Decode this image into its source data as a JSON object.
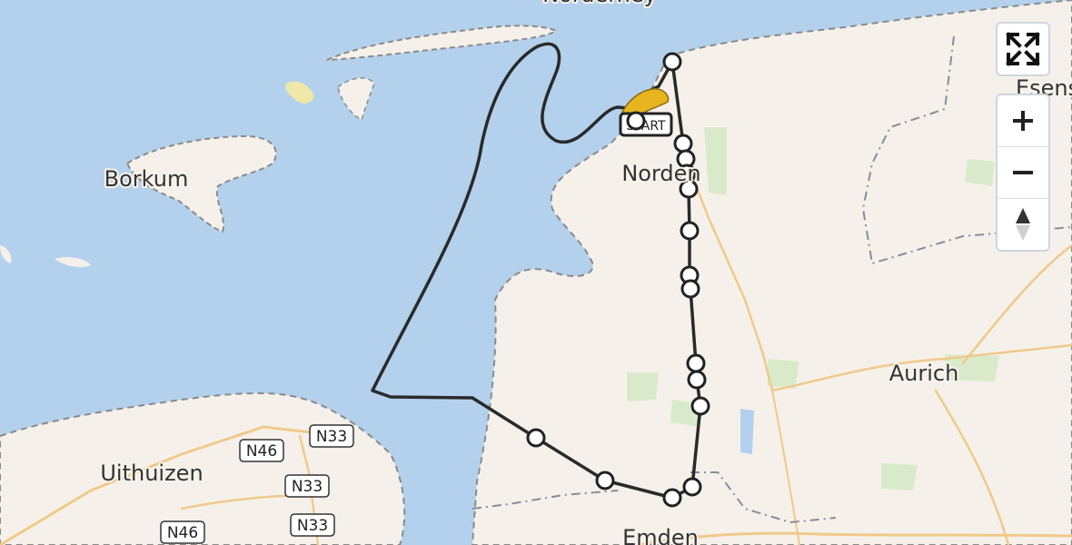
{
  "places": {
    "norderney": "Norderney",
    "borkum": "Borkum",
    "norden": "Norden",
    "esens": "Esens",
    "aurich": "Aurich",
    "uithuizen": "Uithuizen",
    "emden": "Emden"
  },
  "road_shields": [
    "N46",
    "N33",
    "N33",
    "N46",
    "N33"
  ],
  "start_marker": {
    "label": "START"
  },
  "route_stop_count": 16,
  "colors": {
    "water": "#b3d1ec",
    "land": "#f5f1ea",
    "green": "#d9eacb",
    "route": "#222222",
    "start_icon": "#e6b51f"
  },
  "controls": {
    "fullscreen": "fullscreen-icon",
    "zoom_in": "zoom-in-icon",
    "zoom_out": "zoom-out-icon",
    "compass": "compass-icon"
  }
}
